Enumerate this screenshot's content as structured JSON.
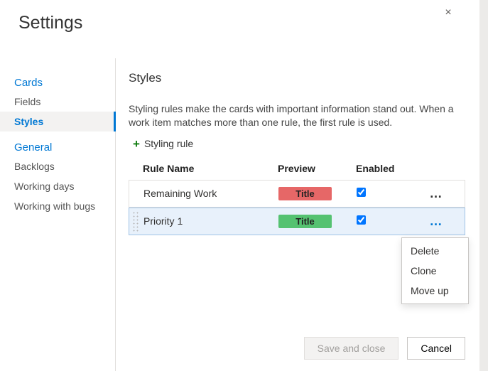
{
  "title": "Settings",
  "close_icon": "×",
  "sidebar": {
    "groups": [
      {
        "header": "Cards",
        "items": [
          {
            "label": "Fields",
            "active": false
          },
          {
            "label": "Styles",
            "active": true
          }
        ]
      },
      {
        "header": "General",
        "items": [
          {
            "label": "Backlogs",
            "active": false
          },
          {
            "label": "Working days",
            "active": false
          },
          {
            "label": "Working with bugs",
            "active": false
          }
        ]
      }
    ]
  },
  "panel": {
    "heading": "Styles",
    "description": "Styling rules make the cards with important information stand out. When a work item matches more than one rule, the first rule is used.",
    "add_label": "Styling rule",
    "columns": {
      "name": "Rule Name",
      "preview": "Preview",
      "enabled": "Enabled"
    },
    "rules": [
      {
        "name": "Remaining Work",
        "preview_label": "Title",
        "color": "red",
        "enabled": true,
        "selected": false
      },
      {
        "name": "Priority 1",
        "preview_label": "Title",
        "color": "green",
        "enabled": true,
        "selected": true
      }
    ]
  },
  "context_menu": {
    "items": [
      {
        "label": "Delete"
      },
      {
        "label": "Clone"
      },
      {
        "label": "Move up"
      }
    ]
  },
  "footer": {
    "save": "Save and close",
    "cancel": "Cancel"
  }
}
